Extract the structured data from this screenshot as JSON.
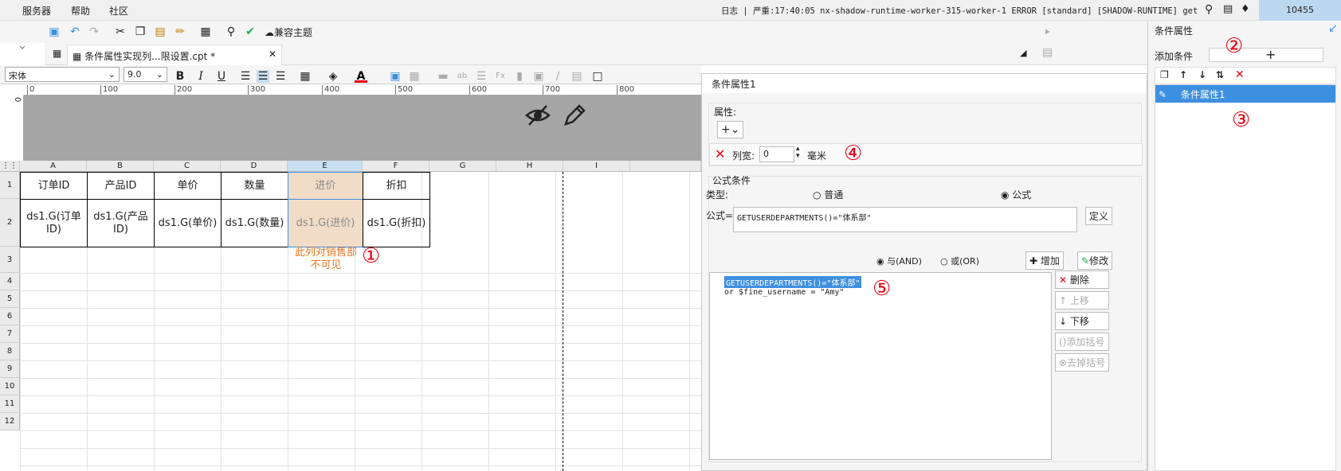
{
  "menu": {
    "server": "服务器",
    "help": "帮助",
    "community": "社区"
  },
  "status": {
    "log_line": "日志 | 严重:17:40:05 nx-shadow-runtime-worker-315-worker-1 ERROR [standard] [SHADOW-RUNTIME] get ...",
    "count": "10455"
  },
  "toolbar": {
    "compat_theme": "兼容主题"
  },
  "tab": {
    "title": "条件属性实现列...限设置.cpt *",
    "close": "✕"
  },
  "format": {
    "font": "宋体",
    "size": "9.0"
  },
  "ruler": [
    "0",
    "100",
    "200",
    "300",
    "400",
    "500",
    "600",
    "700",
    "800"
  ],
  "vruler": "0",
  "grid": {
    "columns": [
      "A",
      "B",
      "C",
      "D",
      "E",
      "F",
      "G",
      "H",
      "I"
    ],
    "rows": [
      "1",
      "2",
      "3",
      "4",
      "5",
      "6",
      "7",
      "8",
      "9",
      "10",
      "11",
      "12"
    ],
    "header_row": [
      "订单ID",
      "产品ID",
      "单价",
      "数量",
      "进价",
      "折扣"
    ],
    "data_row": [
      "ds1.G(订单ID)",
      "ds1.G(产品ID)",
      "ds1.G(单价)",
      "ds1.G(数量)",
      "ds1.G(进价)",
      "ds1.G(折扣)"
    ],
    "annotation": "此列对销售部不可见"
  },
  "dialog": {
    "title": "条件属性1",
    "props_label": "属性:",
    "colwidth_label": "列宽:",
    "colwidth_value": "0",
    "unit": "毫米",
    "formula_cond_label": "公式条件",
    "type_label": "类型:",
    "type_normal": "普通",
    "type_formula": "公式",
    "formula_label": "公式=",
    "formula_value": "GETUSERDEPARTMENTS()=\"体系部\"",
    "define_btn": "定义",
    "and_label": "与(AND)",
    "or_label": "或(OR)",
    "add_btn": "增加",
    "modify_btn": "修改",
    "list": [
      "GETUSERDEPARTMENTS()=\"体系部\"",
      "or  $fine_username = \"Amy\""
    ],
    "delete_btn": "删除",
    "up_btn": "上移",
    "down_btn": "下移",
    "add_bracket_btn": "添加括号",
    "remove_bracket_btn": "去掉括号"
  },
  "right_panel": {
    "title": "条件属性",
    "add_condition": "添加条件",
    "items": [
      "条件属性1"
    ]
  },
  "markers": [
    "①",
    "②",
    "③",
    "④",
    "⑤"
  ],
  "colors": {
    "accent": "#3d8fe0",
    "selection": "#4a90e2",
    "marker_red": "#e60012",
    "cell_highlight": "#f1dcc8"
  }
}
